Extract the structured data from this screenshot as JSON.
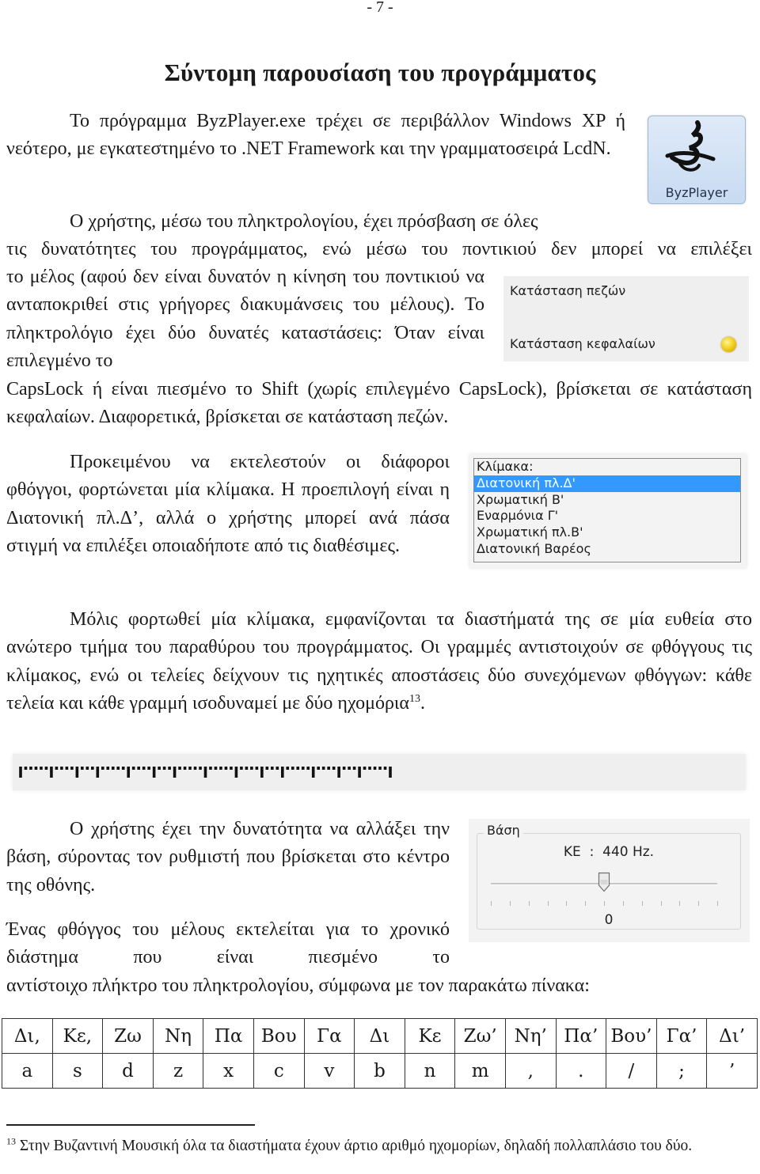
{
  "page_number": "- 7 -",
  "title": "Σύντομη παρουσίαση του προγράμματος",
  "paragraphs": {
    "intro": "Το πρόγραμμα ByzPlayer.exe τρέχει σε περιβάλλον Windows XP ή νεότερο, με εγκατεστημένο το .NET Framework και την γραμματοσειρά LcdN.",
    "keyboard_1": "Ο χρήστης, μέσω του πληκτρολογίου, έχει πρόσβαση σε όλες",
    "keyboard_2": "τις δυνατότητες του προγράμματος, ενώ μέσω του ποντικιού δεν μπορεί να επιλέξει",
    "keyboard_3": "το μέλος (αφού δεν είναι δυνατόν η κίνηση του ποντικιού να ανταποκριθεί στις γρήγορες διακυμάνσεις του μέλους). Το πληκτρολόγιο έχει δύο δυνατές καταστάσεις: Όταν είναι επιλεγμένο το",
    "keyboard_4": "CapsLock ή είναι πιεσμένο το Shift (χωρίς επιλεγμένο CapsLock), βρίσκεται σε κατάσταση κεφαλαίων. Διαφορετικά, βρίσκεται σε κατάσταση πεζών.",
    "scale": "Προκειμένου να εκτελεστούν οι διάφοροι φθόγγοι, φορτώνεται μία κλίμακα. Η προεπιλογή είναι η Διατονική πλ.Δ’, αλλά ο χρήστης μπορεί ανά πάσα στιγμή να επιλέξει οποιαδήποτε από τις διαθέσιμες.",
    "intervals": "Μόλις φορτωθεί μία κλίμακα, εμφανίζονται τα διαστήματά της σε μία ευθεία στο ανώτερο τμήμα του παραθύρου του προγράμματος. Οι γραμμές αντιστοιχούν σε φθόγγους τις κλίμακος, ενώ οι τελείες δείχνουν τις ηχητικές αποστάσεις δύο συνεχόμενων φθόγγων: κάθε τελεία και κάθε γραμμή ισοδυναμεί με δύο ηχομόρια",
    "intervals_footnote_ref": "13",
    "intervals_end": ".",
    "base": "Ο χρήστης έχει την δυνατότητα να αλλάξει την βάση, σύροντας τον ρυθμιστή που βρίσκεται στο κέντρο της οθόνης.",
    "note_1": "Ένας φθόγγος του μέλους εκτελείται για το χρονικό διάστημα που είναι πιεσμένο το",
    "note_2": "αντίστοιχο πλήκτρο του πληκτρολογίου, σύμφωνα με τον παρακάτω πίνακα:"
  },
  "logo": {
    "icon": "byzantine-neume-icon",
    "label": "ByzPlayer"
  },
  "case_panel": {
    "lower_label": "Κατάσταση πεζών",
    "upper_label": "Κατάσταση κεφαλαίων",
    "active": "upper",
    "led_color": "#f3d21e"
  },
  "scale_list": {
    "header": "Κλίμακα:",
    "items": [
      "Διατονική πλ.Δ'",
      "Χρωματική Β'",
      "Εναρμόνια Γ'",
      "Χρωματική πλ.Β'",
      "Διατονική Βαρέος"
    ],
    "selected_index": 0,
    "selection_color": "#3399ff"
  },
  "interval_ruler": {
    "dots_between_lines": [
      5,
      4,
      3,
      5,
      4,
      3,
      5,
      5,
      4,
      3,
      5,
      4,
      3,
      5
    ]
  },
  "base_slider": {
    "group_label": "Βάση",
    "note_label": "ΚΕ  :  440 Hz.",
    "value_label": "0",
    "position_fraction": 0.5,
    "tick_count": 13
  },
  "key_table": {
    "notes": [
      "Δι,",
      "Κε,",
      "Ζω",
      "Νη",
      "Πα",
      "Βου",
      "Γα",
      "Δι",
      "Κε",
      "Ζω’",
      "Νη’",
      "Πα’",
      "Βου’",
      "Γα’",
      "Δι’"
    ],
    "keys": [
      "a",
      "s",
      "d",
      "z",
      "x",
      "c",
      "v",
      "b",
      "n",
      "m",
      ",",
      ".",
      "/",
      ";",
      "’"
    ]
  },
  "footnote": {
    "number": "13",
    "text": " Στην Βυζαντινή Μουσική όλα τα διαστήματα έχουν άρτιο αριθμό ηχομορίων, δηλαδή πολλαπλάσιο του δύο."
  }
}
